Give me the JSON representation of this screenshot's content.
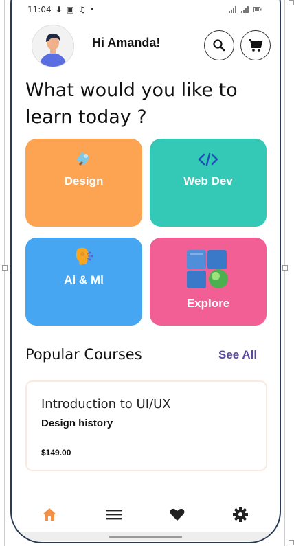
{
  "status_bar": {
    "time": "11:04"
  },
  "header": {
    "greeting": "Hi Amanda!"
  },
  "headline": "What would you like to learn today ?",
  "categories": [
    {
      "label": "Design",
      "color": "#fda453",
      "icon": "pen-tool-icon"
    },
    {
      "label": "Web Dev",
      "color": "#33c9b6",
      "icon": "code-icon"
    },
    {
      "label": "Ai & Ml",
      "color": "#46a6f2",
      "icon": "ai-head-icon"
    },
    {
      "label": "Explore",
      "color": "#f25f94",
      "icon": "cubes-icon"
    }
  ],
  "popular": {
    "title": "Popular Courses",
    "see_all": "See All",
    "course": {
      "title": "Introduction to UI/UX",
      "subtitle": "Design history",
      "price": "$149.00"
    }
  },
  "bottom_nav": [
    {
      "icon": "home-icon",
      "active": true,
      "color": "#f0924a"
    },
    {
      "icon": "menu-icon",
      "active": false
    },
    {
      "icon": "heart-icon",
      "active": false
    },
    {
      "icon": "gear-icon",
      "active": false
    }
  ]
}
